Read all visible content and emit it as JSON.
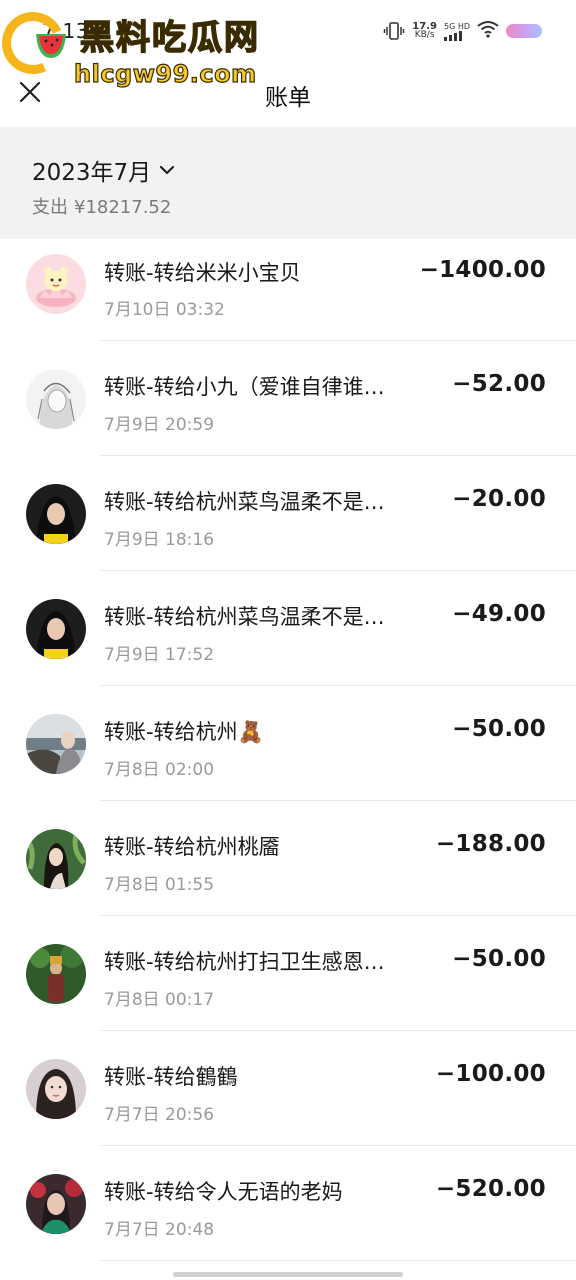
{
  "status_bar": {
    "time": "7:13",
    "net_speed_value": "17.9",
    "net_speed_unit": "KB/s",
    "net_type_top": "5G HD",
    "net_type_bottom": "▮▮▮▮"
  },
  "watermark": {
    "title": "黑料吃瓜网",
    "url": "hlcgw99.com"
  },
  "header": {
    "title": "账单",
    "close_icon": "close-icon"
  },
  "summary": {
    "month": "2023年7月",
    "expense_label": "支出",
    "expense_amount": "¥18217.52"
  },
  "colors": {
    "summary_bg": "#f2f2f2",
    "secondary_text": "#9a9a9a",
    "watermark_yellow": "#f7c82c"
  },
  "transactions": [
    {
      "name": "转账-转给米米小宝贝",
      "time": "7月10日 03:32",
      "amount": "−1400.00",
      "avatar": "lotus-cartoon-avatar"
    },
    {
      "name": "转账-转给小九（爱谁自律谁…",
      "time": "7月9日 20:59",
      "amount": "−52.00",
      "avatar": "sketch-girl-avatar"
    },
    {
      "name": "转账-转给杭州菜鸟温柔不是…",
      "time": "7月9日 18:16",
      "amount": "−20.00",
      "avatar": "girl-yellow-avatar"
    },
    {
      "name": "转账-转给杭州菜鸟温柔不是…",
      "time": "7月9日 17:52",
      "amount": "−49.00",
      "avatar": "girl-yellow-avatar"
    },
    {
      "name": "转账-转给杭州🧸",
      "time": "7月8日 02:00",
      "amount": "−50.00",
      "avatar": "seaside-girl-avatar"
    },
    {
      "name": "转账-转给杭州桃靥",
      "time": "7月8日 01:55",
      "amount": "−188.00",
      "avatar": "plant-girl-avatar"
    },
    {
      "name": "转账-转给杭州打扫卫生感恩…",
      "time": "7月8日 00:17",
      "amount": "−50.00",
      "avatar": "garden-avatar"
    },
    {
      "name": "转账-转给鶴鶴",
      "time": "7月7日 20:56",
      "amount": "−100.00",
      "avatar": "selfie-girl-avatar"
    },
    {
      "name": "转账-转给令人无语的老妈",
      "time": "7月7日 20:48",
      "amount": "−520.00",
      "avatar": "flowers-woman-avatar"
    }
  ]
}
